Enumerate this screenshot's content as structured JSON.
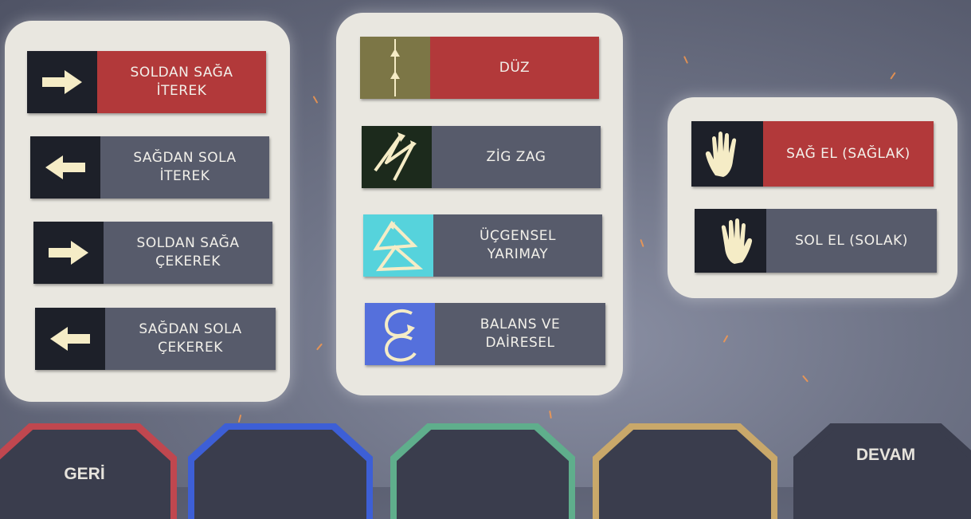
{
  "direction_options": [
    {
      "label": "SOLDAN SAĞA\nİTEREK",
      "icon": "arrow-right-icon",
      "selected": true
    },
    {
      "label": "SAĞDAN SOLA\nİTEREK",
      "icon": "arrow-left-icon",
      "selected": false
    },
    {
      "label": "SOLDAN SAĞA\nÇEKEREK",
      "icon": "arrow-right-icon",
      "selected": false
    },
    {
      "label": "SAĞDAN SOLA\nÇEKEREK",
      "icon": "arrow-left-icon",
      "selected": false
    }
  ],
  "pattern_options": [
    {
      "label": "DÜZ",
      "icon": "straight-line-icon",
      "selected": true
    },
    {
      "label": "ZİG ZAG",
      "icon": "zigzag-icon",
      "selected": false
    },
    {
      "label": "ÜÇGENSEL\nYARIMAY",
      "icon": "triangle-crescent-icon",
      "selected": false
    },
    {
      "label": "BALANS VE\nDAİRESEL",
      "icon": "circular-icon",
      "selected": false
    }
  ],
  "hand_options": [
    {
      "label": "SAĞ EL (SAĞLAK)",
      "icon": "right-hand-icon",
      "selected": true
    },
    {
      "label": "SOL EL (SOLAK)",
      "icon": "left-hand-icon",
      "selected": false
    }
  ],
  "bottom_buttons": [
    {
      "label": "GERİ",
      "color": "#c0474f"
    },
    {
      "label": "",
      "color": "#3d5fd6"
    },
    {
      "label": "",
      "color": "#5fae8c"
    },
    {
      "label": "",
      "color": "#c9a86a"
    },
    {
      "label": "DEVAM",
      "color": "#3a3d4d"
    }
  ],
  "colors": {
    "selected": "#b2393a",
    "unselected": "#575b6b",
    "icon_bg": "#1d2029",
    "icon_fg": "#f5ecc6"
  }
}
